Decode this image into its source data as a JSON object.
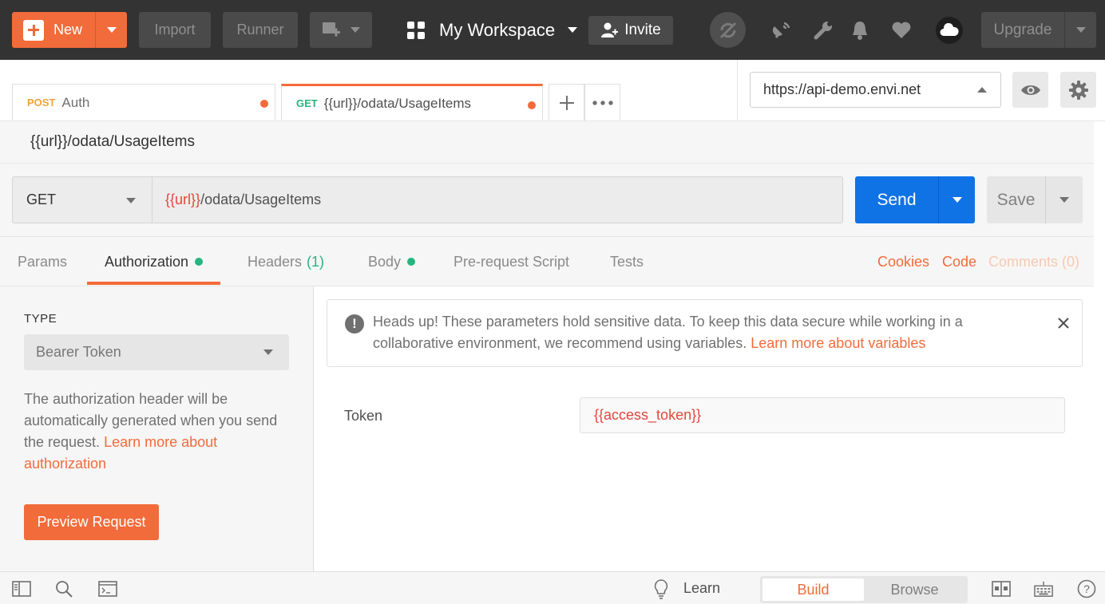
{
  "topbar": {
    "new_label": "New",
    "import_label": "Import",
    "runner_label": "Runner",
    "workspace_label": "My Workspace",
    "invite_label": "Invite",
    "upgrade_label": "Upgrade"
  },
  "tabs": [
    {
      "method": "POST",
      "method_color": "#f2a33a",
      "title": "Auth",
      "unsaved": true
    },
    {
      "method": "GET",
      "method_color": "#26b47f",
      "title": "{{url}}/odata/UsageItems",
      "unsaved": true,
      "active": true
    }
  ],
  "environment": {
    "selected": "https://api-demo.envi.net"
  },
  "request": {
    "name": "{{url}}/odata/UsageItems",
    "method": "GET",
    "url_var": "{{url}}",
    "url_path": "/odata/UsageItems",
    "send_label": "Send",
    "save_label": "Save"
  },
  "subtabs": {
    "params": "Params",
    "authorization": "Authorization",
    "headers": "Headers",
    "headers_count": "(1)",
    "body": "Body",
    "prerequest": "Pre-request Script",
    "tests": "Tests",
    "cookies": "Cookies",
    "code": "Code",
    "comments": "Comments (0)"
  },
  "auth": {
    "type_label": "TYPE",
    "type_value": "Bearer Token",
    "desc_text": "The authorization header will be automatically generated when you send the request.",
    "desc_link": "Learn more about authorization",
    "preview_label": "Preview Request"
  },
  "alert": {
    "text": "Heads up! These parameters hold sensitive data. To keep this data secure while working in a collaborative environment, we recommend using variables.",
    "link": "Learn more about variables",
    "icon": "!"
  },
  "token": {
    "label": "Token",
    "value": "{{access_token}}"
  },
  "statusbar": {
    "learn_label": "Learn",
    "build_label": "Build",
    "browse_label": "Browse"
  },
  "colors": {
    "brand": "#f26b3a",
    "send": "#0f73e6",
    "topbar": "#333333",
    "variable": "#e2473c",
    "green": "#26b47f"
  }
}
